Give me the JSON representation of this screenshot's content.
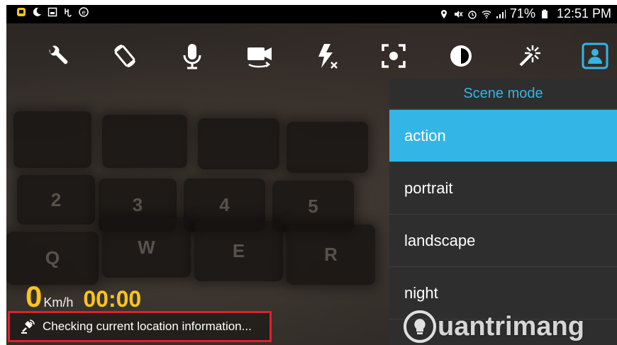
{
  "status_bar": {
    "battery": "71%",
    "time": "12:51 PM"
  },
  "toolbar": {
    "buttons": [
      "settings-wrench",
      "rotate-screen",
      "microphone",
      "switch-camera",
      "flash-off",
      "focus",
      "exposure",
      "effects",
      "scene-mode"
    ]
  },
  "scene_menu": {
    "title": "Scene mode",
    "selected": "action",
    "items": [
      "action",
      "portrait",
      "landscape",
      "night"
    ]
  },
  "speed": {
    "value": "0",
    "unit": "Km/h",
    "timer": "00:00"
  },
  "location": {
    "message": "Checking current location information..."
  },
  "watermark": {
    "text": "uantrimang"
  },
  "colors": {
    "accent": "#33b5e5",
    "speed": "#f7c51e",
    "highlight_border": "#e0202a"
  }
}
